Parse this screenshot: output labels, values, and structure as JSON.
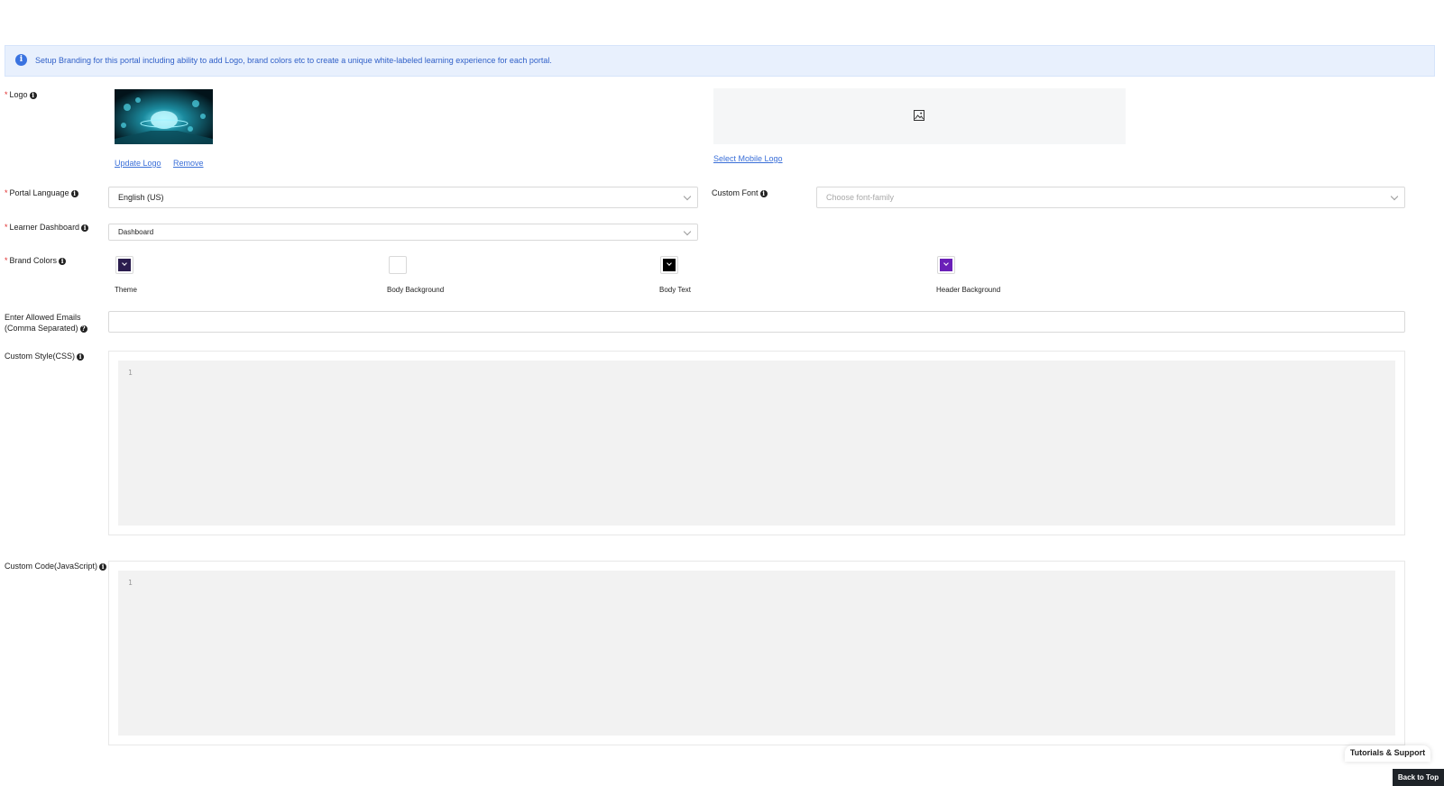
{
  "banner": {
    "info_icon": "info-icon",
    "text": "Setup Branding for this portal including ability to add Logo, brand colors etc to create a unique white-labeled learning experience for each portal."
  },
  "logo": {
    "label": "Logo",
    "update_link": "Update Logo",
    "remove_link": "Remove",
    "mobile_placeholder_icon": "image-icon",
    "select_mobile_link": "Select Mobile Logo"
  },
  "portal_language": {
    "label": "Portal Language",
    "value": "English (US)"
  },
  "custom_font": {
    "label": "Custom Font",
    "placeholder": "Choose font-family"
  },
  "learner_dashboard": {
    "label": "Learner Dashboard",
    "value": "Dashboard"
  },
  "brand_colors": {
    "label": "Brand Colors",
    "items": [
      {
        "caption": "Theme",
        "color": "#2b1d4e"
      },
      {
        "caption": "Body Background",
        "color": "#ffffff"
      },
      {
        "caption": "Body Text",
        "color": "#000000"
      },
      {
        "caption": "Header Background",
        "color": "#6a1fb8"
      }
    ]
  },
  "allowed_emails": {
    "label_line1": "Enter Allowed Emails",
    "label_line2": "(Comma Separated)",
    "value": ""
  },
  "custom_css": {
    "label": "Custom Style(CSS)",
    "line_number": "1"
  },
  "custom_js": {
    "label": "Custom Code(JavaScript)",
    "line_number": "1"
  },
  "footer": {
    "tutorials": "Tutorials & Support",
    "back_to_top": "Back to Top"
  },
  "colors": {
    "accent": "#3a6fd8",
    "required": "#e03030",
    "banner_bg": "#e8f0fd"
  }
}
